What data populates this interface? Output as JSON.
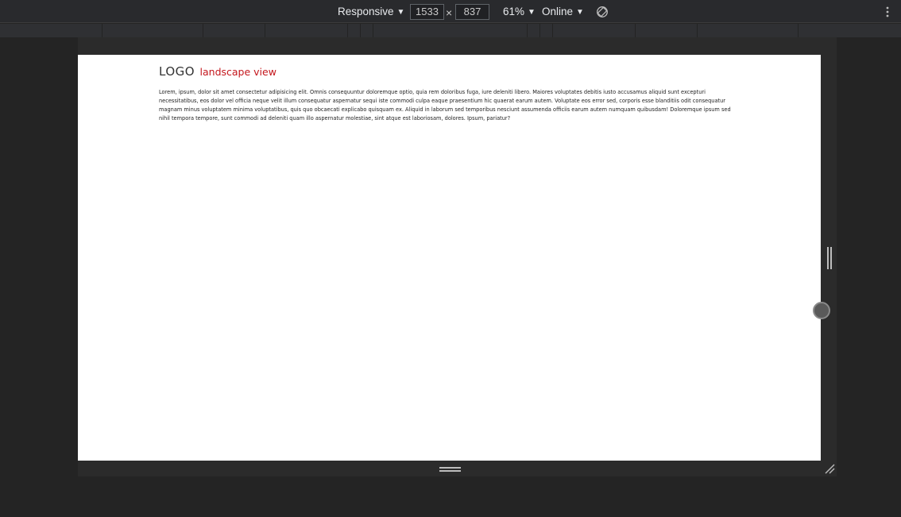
{
  "toolbar": {
    "device": "Responsive",
    "width": "1533",
    "times": "×",
    "height": "837",
    "zoom": "61%",
    "throttle": "Online",
    "caret": "▼",
    "icons": [
      "rotate-icon",
      "more-vertical-icon"
    ]
  },
  "page": {
    "logo": "LOGO",
    "subtitle": "landscape view",
    "body": "Lorem, ipsum, dolor sit amet consectetur adipisicing elit. Omnis consequuntur doloremque optio, quia rem doloribus fuga, iure deleniti libero. Maiores voluptates debitis iusto accusamus aliquid sunt excepturi necessitatibus, eos dolor vel officia neque velit illum consequatur aspernatur sequi iste commodi culpa eaque praesentium hic quaerat earum autem. Voluptate eos error sed, corporis esse blanditiis odit consequatur magnam minus voluptatem minima voluptatibus, quis quo obcaecati explicabo quisquam ex. Aliquid in laborum sed temporibus nesciunt assumenda officiis earum autem numquam quibusdam! Doloremque ipsum sed nihil tempora tempore, sunt commodi ad deleniti quam illo aspernatur molestiae, sint atque est laboriosam, dolores. Ipsum, pariatur?"
  },
  "colors": {
    "accent": "#c4161c",
    "chrome_bg": "#242424",
    "toolbar_bg": "#292a2d"
  }
}
